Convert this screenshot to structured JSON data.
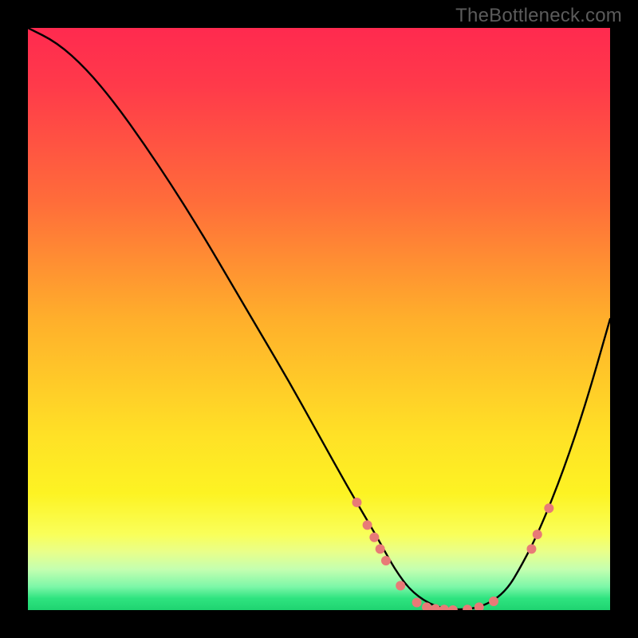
{
  "watermark": "TheBottleneck.com",
  "chart_data": {
    "type": "line",
    "title": "",
    "xlabel": "",
    "ylabel": "",
    "xlim": [
      0,
      100
    ],
    "ylim": [
      0,
      100
    ],
    "curve": {
      "name": "bottleneck-curve",
      "x": [
        0,
        5,
        10,
        15,
        20,
        25,
        30,
        35,
        40,
        45,
        50,
        55,
        60,
        63,
        66,
        70,
        74,
        78,
        82,
        85,
        88,
        92,
        96,
        100
      ],
      "y": [
        100,
        97.5,
        93,
        87,
        80,
        72.5,
        64.5,
        56,
        47.5,
        39,
        30,
        21,
        12.5,
        7,
        3,
        0.5,
        0,
        0.5,
        3,
        8,
        14,
        24,
        36,
        50
      ]
    },
    "points": {
      "name": "highlighted-points",
      "color": "#e87a77",
      "radius": 6,
      "data": [
        {
          "x": 56.5,
          "y": 18.5
        },
        {
          "x": 58.3,
          "y": 14.6
        },
        {
          "x": 59.5,
          "y": 12.5
        },
        {
          "x": 60.5,
          "y": 10.5
        },
        {
          "x": 61.5,
          "y": 8.5
        },
        {
          "x": 64.0,
          "y": 4.2
        },
        {
          "x": 66.8,
          "y": 1.3
        },
        {
          "x": 68.5,
          "y": 0.5
        },
        {
          "x": 70.0,
          "y": 0.2
        },
        {
          "x": 71.5,
          "y": 0.1
        },
        {
          "x": 73.0,
          "y": 0.0
        },
        {
          "x": 75.5,
          "y": 0.1
        },
        {
          "x": 77.5,
          "y": 0.5
        },
        {
          "x": 80.0,
          "y": 1.5
        },
        {
          "x": 86.5,
          "y": 10.5
        },
        {
          "x": 87.5,
          "y": 13.0
        },
        {
          "x": 89.5,
          "y": 17.5
        }
      ]
    }
  }
}
